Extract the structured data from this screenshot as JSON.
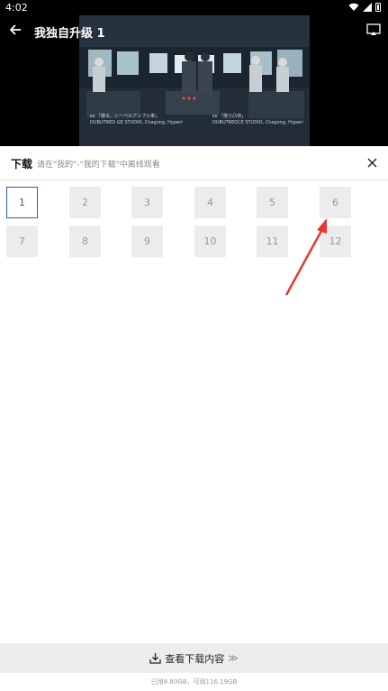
{
  "status_bar": {
    "time": "4:02"
  },
  "player": {
    "title": "我独自升级 1"
  },
  "credits": {
    "left_line1": "ᴇᴅ 「散る、シーベルアップ火車」",
    "left_line2": "DUBUTRED GE STUDIO, Chagong, Hyperr",
    "right_line1": "ᴇᴅ 「散ら凸待」",
    "right_line2": "DUBUTREDCE STUDIO, Chagong, Hyperr"
  },
  "download_panel": {
    "title": "下载",
    "hint": "请在\"我的\"-\"我的下载\"中离线观看",
    "episodes": [
      "1",
      "2",
      "3",
      "4",
      "5",
      "6",
      "7",
      "8",
      "9",
      "10",
      "11",
      "12"
    ],
    "selected_episode": "1"
  },
  "bottom_bar": {
    "label": "查看下载内容",
    "chevron": "≫",
    "storage": "已用8.80GB，可用116.19GB"
  },
  "colors": {
    "selected_border": "#2f5fa8",
    "arrow": "#e53935"
  }
}
